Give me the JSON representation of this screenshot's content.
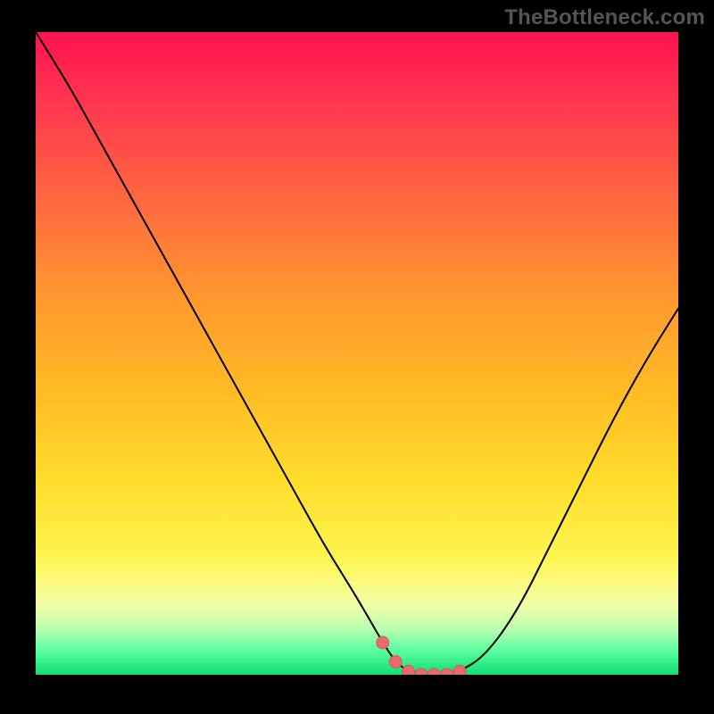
{
  "watermark": "TheBottleneck.com",
  "colors": {
    "frame_bg": "#000000",
    "watermark_text": "#555555",
    "curve_stroke": "#000000",
    "marker_fill": "#e86b6b",
    "marker_stroke": "#cf5a5a",
    "gradient_stops": [
      {
        "pct": 0,
        "hex": "#ff1250"
      },
      {
        "pct": 12,
        "hex": "#ff3a4e"
      },
      {
        "pct": 28,
        "hex": "#ff6e3e"
      },
      {
        "pct": 42,
        "hex": "#ff9a2e"
      },
      {
        "pct": 56,
        "hex": "#ffbb25"
      },
      {
        "pct": 70,
        "hex": "#ffde2b"
      },
      {
        "pct": 82,
        "hex": "#fff552"
      },
      {
        "pct": 89,
        "hex": "#f4ffa6"
      },
      {
        "pct": 93,
        "hex": "#b7ffb0"
      },
      {
        "pct": 96,
        "hex": "#5fffa2"
      },
      {
        "pct": 100,
        "hex": "#10df72"
      }
    ]
  },
  "chart_data": {
    "type": "line",
    "title": "",
    "xlabel": "",
    "ylabel": "",
    "xlim": [
      0,
      100
    ],
    "ylim": [
      0,
      100
    ],
    "x": [
      0,
      5,
      10,
      15,
      20,
      25,
      30,
      35,
      40,
      45,
      50,
      54,
      56,
      58,
      60,
      62,
      64,
      66,
      70,
      75,
      80,
      85,
      90,
      95,
      100
    ],
    "values": [
      100,
      92,
      83,
      74,
      65,
      56,
      47,
      38,
      29,
      20,
      12,
      5,
      2,
      0.5,
      0,
      0,
      0,
      0.5,
      3,
      10,
      20,
      30,
      40,
      49,
      57
    ],
    "highlight": {
      "x": [
        54,
        56,
        58,
        60,
        62,
        64,
        66
      ],
      "values": [
        5,
        2,
        0.5,
        0,
        0,
        0,
        0.5
      ]
    }
  }
}
